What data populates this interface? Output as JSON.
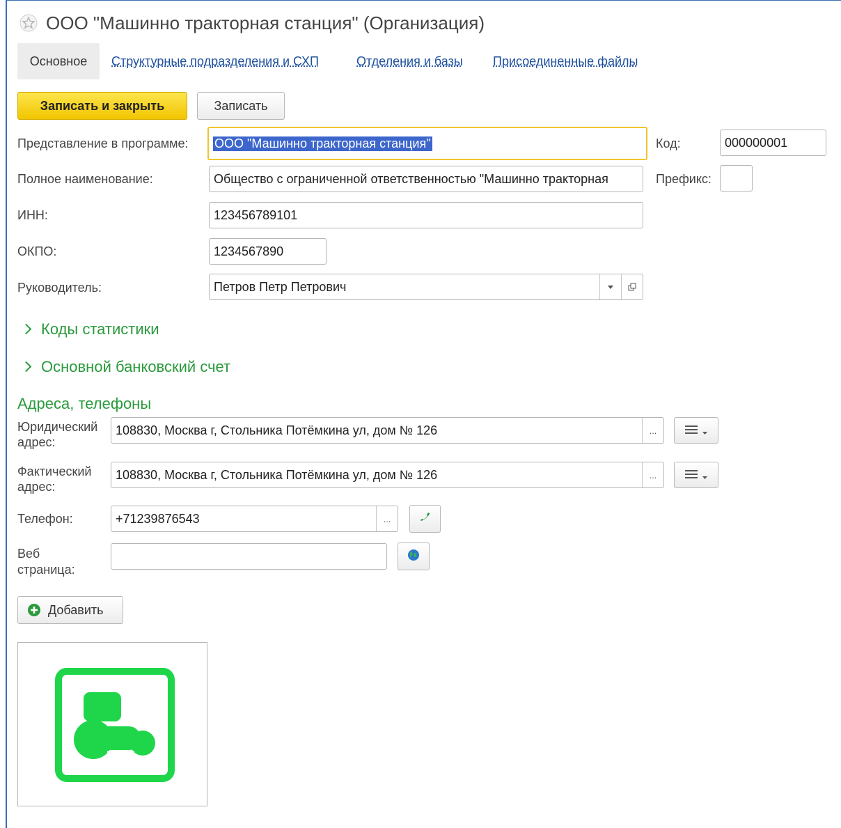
{
  "window": {
    "title": "ООО \"Машинно тракторная станция\" (Организация)"
  },
  "tabs": [
    {
      "label": "Основное",
      "active": true
    },
    {
      "label": "Структурные подразделения и СХП",
      "active": false
    },
    {
      "label": "Отделения и базы",
      "active": false
    },
    {
      "label": "Присоединенные файлы",
      "active": false
    }
  ],
  "toolbar": {
    "save_close_label": "Записать и закрыть",
    "save_label": "Записать"
  },
  "form": {
    "presentation_label": "Представление в программе:",
    "presentation_value": "ООО \"Машинно тракторная станция\"",
    "code_label": "Код:",
    "code_value": "000000001",
    "full_name_label": "Полное наименование:",
    "full_name_value": "Общество с ограниченной ответственностью \"Машинно тракторная",
    "prefix_label": "Префикс:",
    "prefix_value": "",
    "inn_label": "ИНН:",
    "inn_value": "123456789101",
    "okpo_label": "ОКПО:",
    "okpo_value": "1234567890",
    "director_label": "Руководитель:",
    "director_value": "Петров Петр Петрович"
  },
  "sections": {
    "stat_codes": "Коды статистики",
    "bank_account": "Основной банковский счет",
    "addresses_title": "Адреса, телефоны"
  },
  "contacts": {
    "legal_label_1": "Юридический",
    "legal_label_2": "адрес:",
    "legal_value": "108830, Москва г, Стольника Потёмкина ул, дом № 126",
    "actual_label_1": "Фактический",
    "actual_label_2": "адрес:",
    "actual_value": "108830, Москва г, Стольника Потёмкина ул, дом № 126",
    "phone_label": "Телефон:",
    "phone_value": "+71239876543",
    "web_label_1": "Веб",
    "web_label_2": "страница:",
    "web_value": "",
    "ellipsis": "...",
    "add_label": "Добавить"
  },
  "colors": {
    "accent_green": "#2a9a3c",
    "logo_green": "#1fd64a",
    "primary_yellow": "#f1c500",
    "link_blue": "#1d4f9e"
  }
}
